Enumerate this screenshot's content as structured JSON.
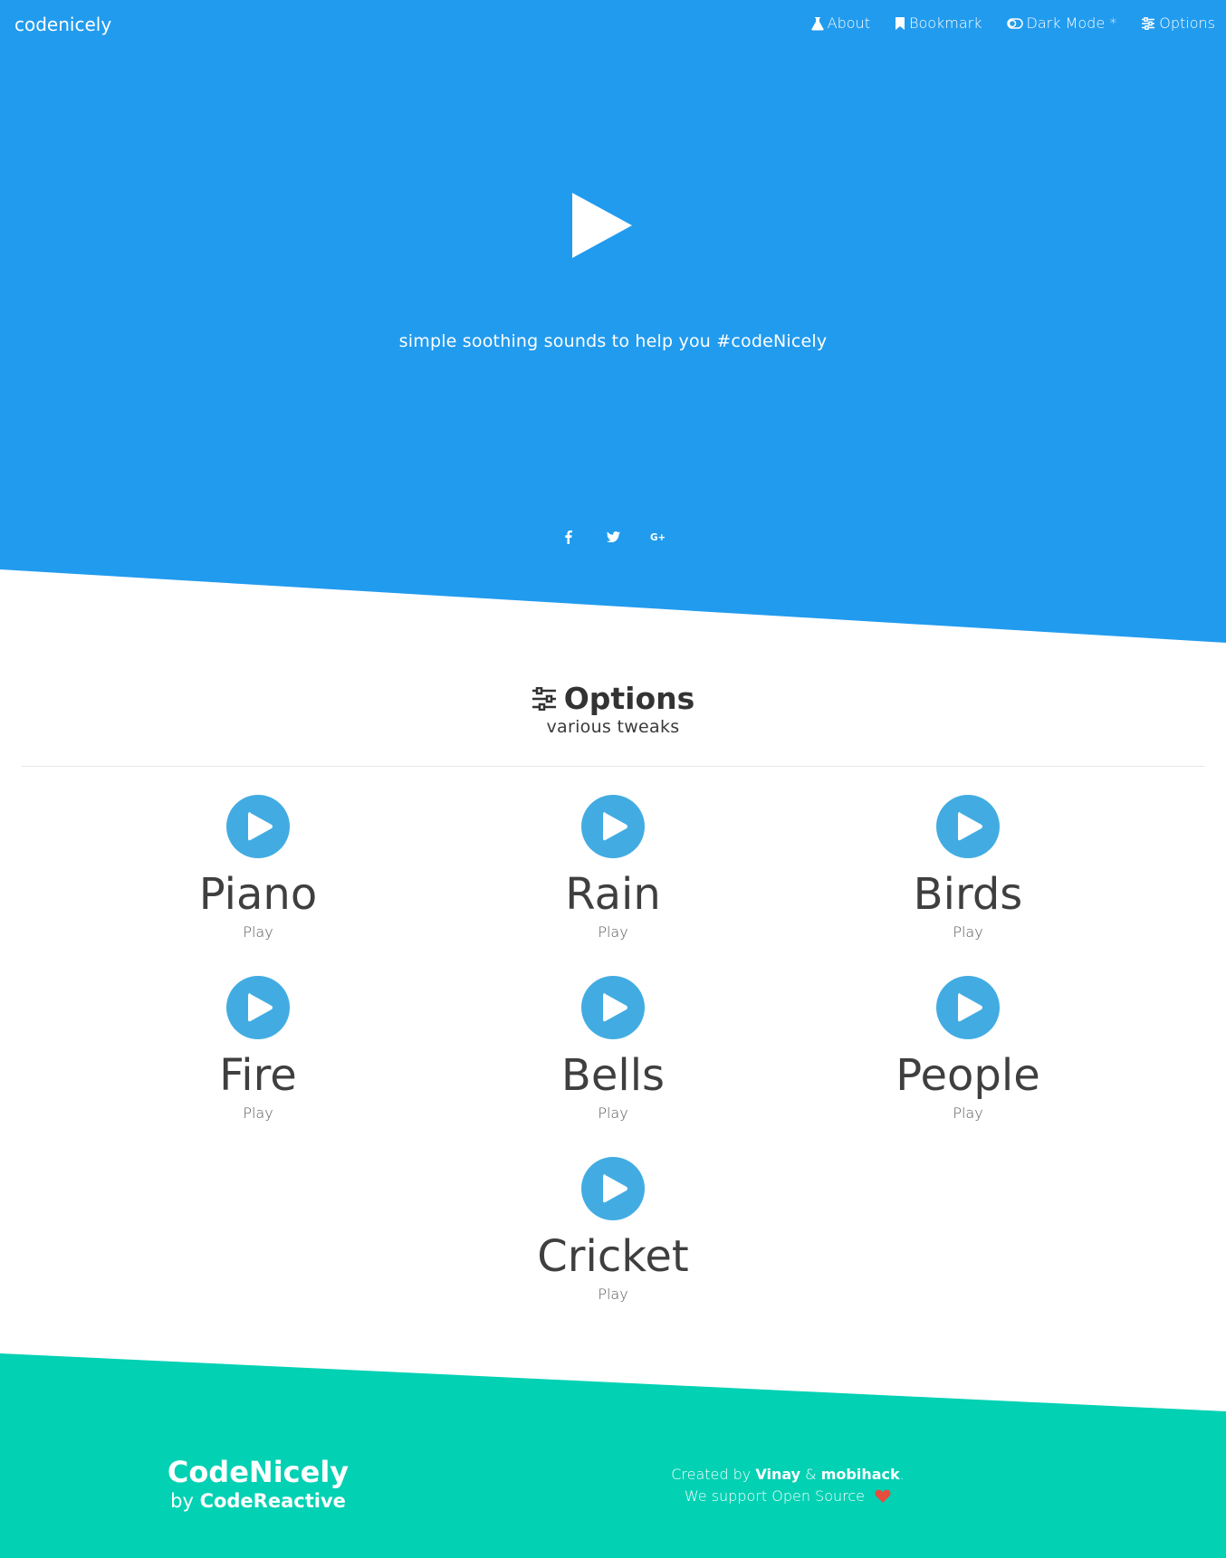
{
  "brand": "codenicely",
  "nav": [
    {
      "label": "About",
      "icon": "flask-icon"
    },
    {
      "label": "Bookmark",
      "icon": "bookmark-icon"
    },
    {
      "label": "Dark Mode *",
      "icon": "toggle-icon"
    },
    {
      "label": "Options",
      "icon": "sliders-icon"
    }
  ],
  "hero": {
    "tagline": "simple soothing sounds to help you #codeNicely",
    "socials": [
      "facebook-icon",
      "twitter-icon",
      "google-plus-icon"
    ]
  },
  "options": {
    "title": "Options",
    "subtitle": "various tweaks"
  },
  "sounds": [
    {
      "name": "Piano",
      "action": "Play"
    },
    {
      "name": "Rain",
      "action": "Play"
    },
    {
      "name": "Birds",
      "action": "Play"
    },
    {
      "name": "Fire",
      "action": "Play"
    },
    {
      "name": "Bells",
      "action": "Play"
    },
    {
      "name": "People",
      "action": "Play"
    },
    {
      "name": "Cricket",
      "action": "Play"
    }
  ],
  "footer": {
    "title": "CodeNicely",
    "by_prefix": "by",
    "by_name": "CodeReactive",
    "created_prefix": "Created by",
    "author1": "Vinay",
    "amp": "&",
    "author2": "mobihack",
    "period": ".",
    "support": "We support Open Source"
  },
  "colors": {
    "hero_bg": "#219bee",
    "play_button": "#42ace2",
    "footer_bg": "#02d1b3",
    "heart": "#e74c3c"
  }
}
